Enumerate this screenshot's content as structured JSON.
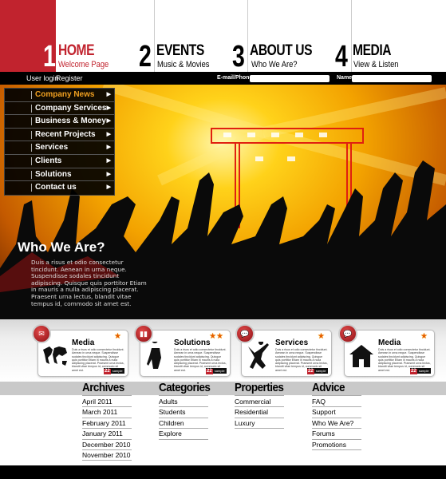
{
  "nav": [
    {
      "num": "1",
      "title": "HOME",
      "sub": "Welcome Page"
    },
    {
      "num": "2",
      "title": "EVENTS",
      "sub": "Music & Movies"
    },
    {
      "num": "3",
      "title": "ABOUT US",
      "sub": "Who We Are?"
    },
    {
      "num": "4",
      "title": "MEDIA",
      "sub": "View & Listen"
    }
  ],
  "topbar": {
    "login": "User login",
    "register": "Register",
    "email_label": "E-mail/Phone",
    "name_label": "Name",
    "email_value": "",
    "name_value": ""
  },
  "menu": [
    "Company News",
    "Company Services",
    "Business & Money",
    "Recent Projects",
    "Services",
    "Clients",
    "Solutions",
    "Contact us"
  ],
  "menu_active_color": "#f0a020",
  "hero": {
    "title": "Who We Are?",
    "text": "Duis a risus et odio consectetur tincidunt. Aenean in urna neque. Suspendisse sodales tincidunt adipiscing. Quisque quis porttitor Etiam in mauris a nulla adipiscing placerat. Praesent urna lectus, blandit vitae tempus id, commodo sit amet est."
  },
  "cards": [
    {
      "title": "Media",
      "icon": "mail-icon",
      "picture": "world-map-icon",
      "stars": "★",
      "badge": "22",
      "badge_label": "sample",
      "text": "Duis a risus et odio consectetur tincidunt. Aenean in urna neque. Suspendisse sodales tincidunt adipiscing. Quisque quis porttitor Etiam in mauris a nulla adipiscing placerat. Praesent urna lectus, blandit vitae tempus id, commodo sit amet est."
    },
    {
      "title": "Solutions",
      "icon": "bar-chart-icon",
      "picture": "saxophone-player-icon",
      "stars": "★★",
      "badge": "22",
      "badge_label": "sample",
      "text": "Duis a risus et odio consectetur tincidunt. Aenean in urna neque. Suspendisse sodales tincidunt adipiscing. Quisque quis porttitor Etiam in mauris a nulla adipiscing placerat. Praesent urna lectus, blandit vitae tempus id, commodo sit amet est."
    },
    {
      "title": "Services",
      "icon": "speech-bubble-icon",
      "picture": "jumping-person-icon",
      "stars": "★",
      "badge": "22",
      "badge_label": "sample",
      "text": "Duis a risus et odio consectetur tincidunt. Aenean in urna neque. Suspendisse sodales tincidunt adipiscing. Quisque quis porttitor Etiam in mauris a nulla adipiscing placerat. Praesent urna lectus, blandit vitae tempus id, commodo sit amet est."
    },
    {
      "title": "Media",
      "icon": "speech-bubble-icon",
      "picture": "house-icon",
      "stars": "★",
      "badge": "22",
      "badge_label": "sample",
      "text": "Duis a risus et odio consectetur tincidunt. Aenean in urna neque. Suspendisse sodales tincidunt adipiscing. Quisque quis porttitor Etiam in mauris a nulla adipiscing placerat. Praesent urna lectus, blandit vitae tempus id, commodo sit amet est."
    }
  ],
  "footer": [
    {
      "heading": "Archives",
      "items": [
        "April 2011",
        "March 2011",
        "February 2011",
        "January 2011",
        "December 2010",
        "November 2010"
      ]
    },
    {
      "heading": "Categories",
      "items": [
        "Adults",
        "Students",
        "Children",
        "Explore"
      ]
    },
    {
      "heading": "Properties",
      "items": [
        "Commercial",
        "Residential",
        "Luxury"
      ]
    },
    {
      "heading": "Advice",
      "items": [
        "FAQ",
        "Support",
        "Who We Are?",
        "Forums",
        "Promotions"
      ]
    }
  ],
  "colors": {
    "brand_red": "#c1232e",
    "black": "#000000",
    "accent_orange": "#f0a020"
  }
}
